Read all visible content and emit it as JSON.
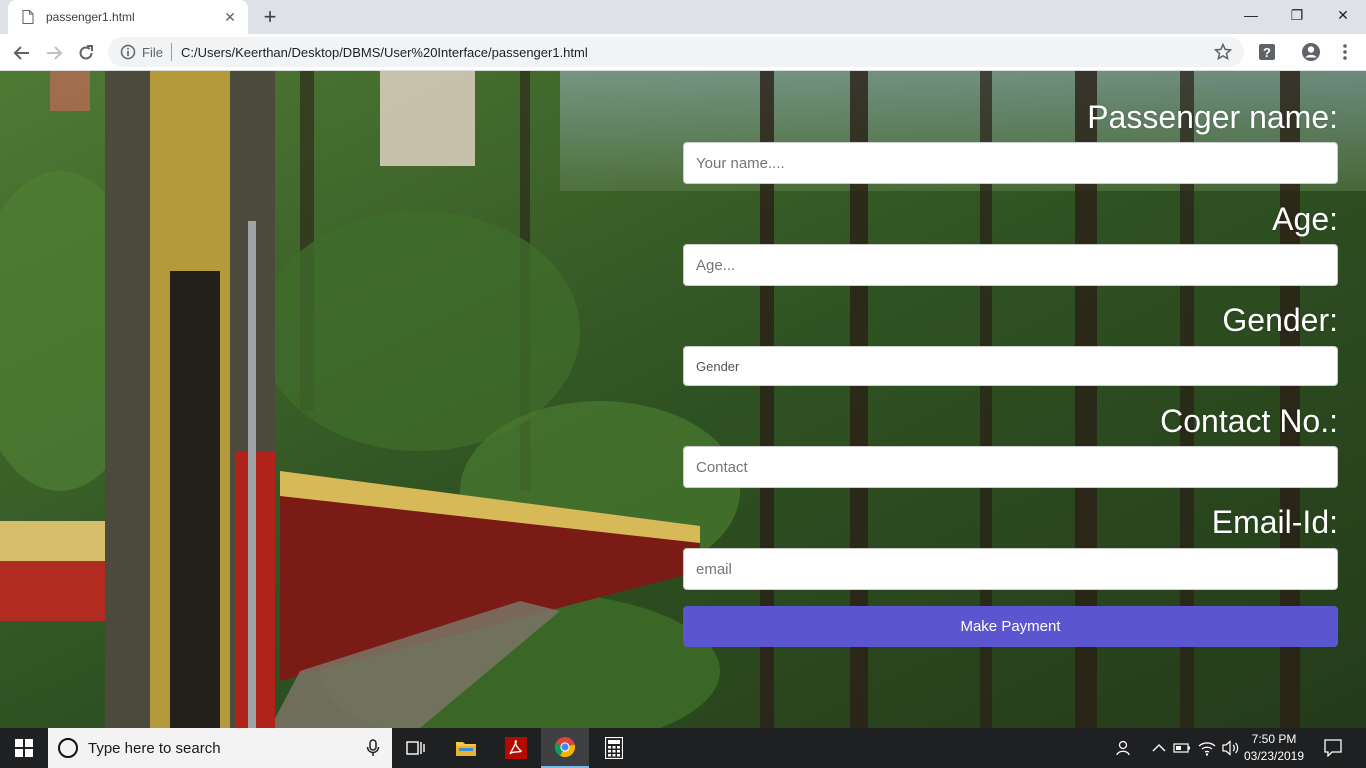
{
  "browser": {
    "tab_title": "passenger1.html",
    "tab_close": "✕",
    "new_tab": "+",
    "scheme_label": "File",
    "url": "C:/Users/Keerthan/Desktop/DBMS/User%20Interface/passenger1.html",
    "window_controls": {
      "minimize": "—",
      "maximize": "❐",
      "close": "✕"
    }
  },
  "form": {
    "name_label": "Passenger name:",
    "name_placeholder": "Your name....",
    "age_label": "Age:",
    "age_placeholder": "Age...",
    "gender_label": "Gender:",
    "gender_value": "Gender",
    "contact_label": "Contact No.:",
    "contact_placeholder": "Contact",
    "email_label": "Email-Id:",
    "email_placeholder": "email",
    "submit_label": "Make Payment"
  },
  "taskbar": {
    "search_placeholder": "Type here to search",
    "time": "7:50 PM",
    "date": "03/23/2019"
  },
  "colors": {
    "button_bg": "#5b56cf",
    "label_text": "#ffffff"
  }
}
